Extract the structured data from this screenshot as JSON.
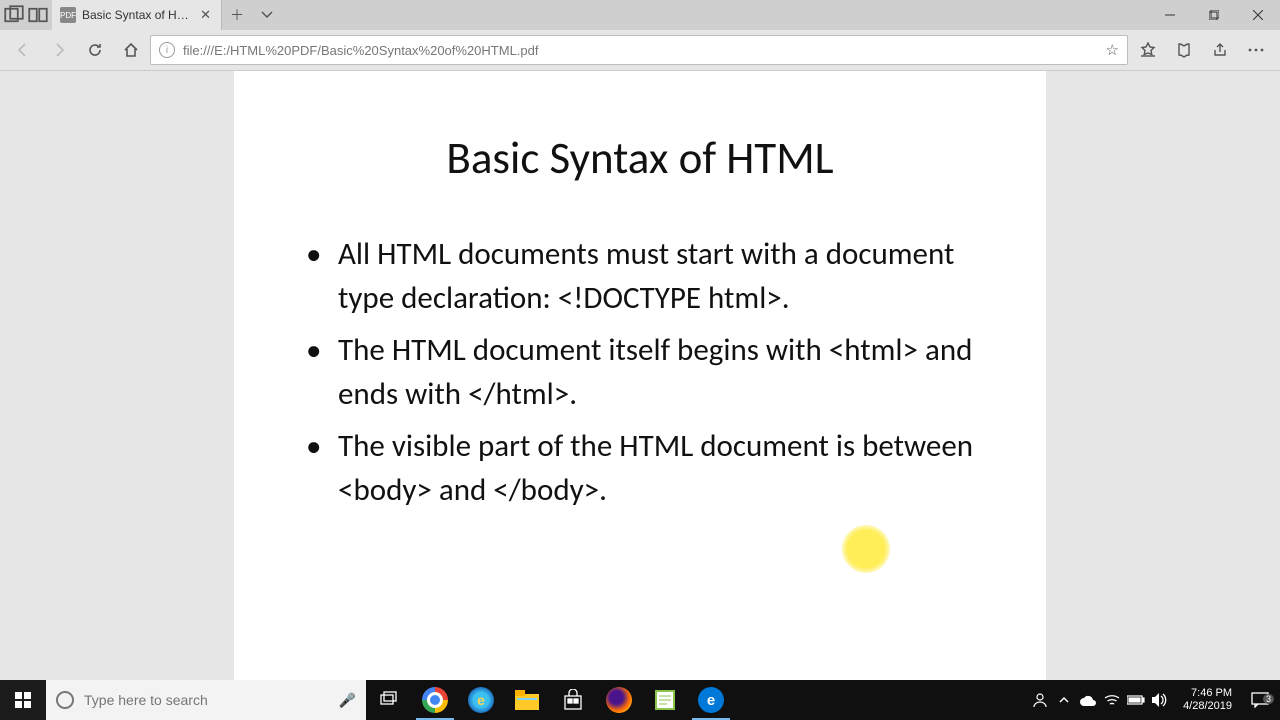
{
  "tab": {
    "title": "Basic Syntax of HTML.pd"
  },
  "url": "file:///E:/HTML%20PDF/Basic%20Syntax%20of%20HTML.pdf",
  "document": {
    "title": "Basic Syntax of HTML",
    "bullets": [
      "All HTML documents must start with a document type declaration: <!DOCTYPE html>.",
      "The HTML document itself begins with <html> and ends with </html>.",
      "The visible part of the HTML document is between <body> and </body>."
    ]
  },
  "search_placeholder": "Type here to search",
  "clock": {
    "time": "7:46 PM",
    "date": "4/28/2019"
  },
  "notif_count": "3"
}
